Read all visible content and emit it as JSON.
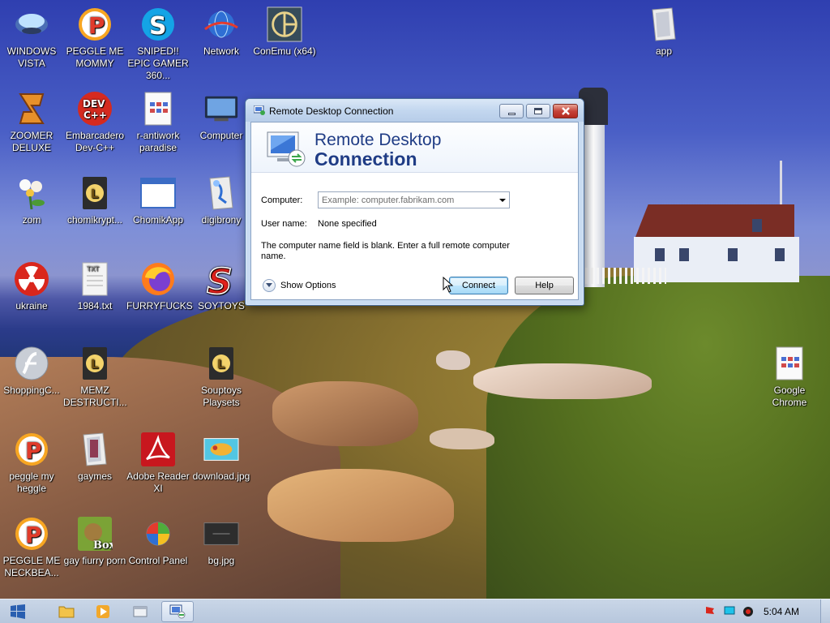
{
  "desktop_icons": [
    {
      "label": "WINDOWS VISTA",
      "icon": "windows-vista-icon"
    },
    {
      "label": "PEGGLE ME MOMMY",
      "icon": "peggle-icon"
    },
    {
      "label": "SNIPED!! EPIC GAMER 360...",
      "icon": "skype-icon"
    },
    {
      "label": "Network",
      "icon": "network-icon"
    },
    {
      "label": "ConEmu (x64)",
      "icon": "conemu-icon"
    },
    {
      "label": "app",
      "icon": "folder-icon"
    },
    {
      "label": "ZOOMER DELUXE",
      "icon": "zuma-icon"
    },
    {
      "label": "Embarcadero Dev-C++",
      "icon": "devcpp-icon"
    },
    {
      "label": "r-antiwork paradise",
      "icon": "document-icon"
    },
    {
      "label": "Computer",
      "icon": "computer-icon"
    },
    {
      "label": "zom",
      "icon": "flower-icon"
    },
    {
      "label": "chomikrypt...",
      "icon": "archive-icon"
    },
    {
      "label": "ChomikApp",
      "icon": "window-icon"
    },
    {
      "label": "digibrony",
      "icon": "folder-icon"
    },
    {
      "label": "ukraine",
      "icon": "radiation-icon"
    },
    {
      "label": "1984.txt",
      "icon": "text-file-icon"
    },
    {
      "label": "FURRYFUCKS",
      "icon": "firefox-icon"
    },
    {
      "label": "SOYTOYS",
      "icon": "s-logo-icon"
    },
    {
      "label": "ShoppingC...",
      "icon": "flash-icon"
    },
    {
      "label": "MEMZ DESTRUCTI...",
      "icon": "archive-icon"
    },
    {
      "label": "Souptoys Playsets",
      "icon": "archive-icon"
    },
    {
      "label": "Google Chrome",
      "icon": "document-icon"
    },
    {
      "label": "peggle my heggle",
      "icon": "peggle-icon"
    },
    {
      "label": "gaymes",
      "icon": "folder-icon"
    },
    {
      "label": "Adobe Reader XI",
      "icon": "adobe-reader-icon"
    },
    {
      "label": "download.jpg",
      "icon": "image-icon"
    },
    {
      "label": "PEGGLE ME NECKBEA...",
      "icon": "peggle-icon"
    },
    {
      "label": "gay fiurry porn",
      "icon": "box-game-icon"
    },
    {
      "label": "Control Panel",
      "icon": "control-panel-icon"
    },
    {
      "label": "bg.jpg",
      "icon": "image-icon"
    }
  ],
  "dialog": {
    "title": "Remote Desktop Connection",
    "banner_line1": "Remote Desktop",
    "banner_line2": "Connection",
    "computer_label": "Computer:",
    "computer_placeholder": "Example: computer.fabrikam.com",
    "computer_value": "",
    "username_label": "User name:",
    "username_value": "None specified",
    "message": "The computer name field is blank. Enter a full remote computer name.",
    "show_options": "Show Options",
    "connect": "Connect",
    "help": "Help"
  },
  "taskbar": {
    "clock": "5:04 AM",
    "pinned": [
      "start-button",
      "file-explorer-icon",
      "media-player-icon",
      "window-icon",
      "remote-desktop-icon"
    ]
  },
  "colors": {
    "dialog_title_blue": "#1f3c85",
    "taskbar": "#b7c7dd",
    "close_button": "#c5443a"
  }
}
